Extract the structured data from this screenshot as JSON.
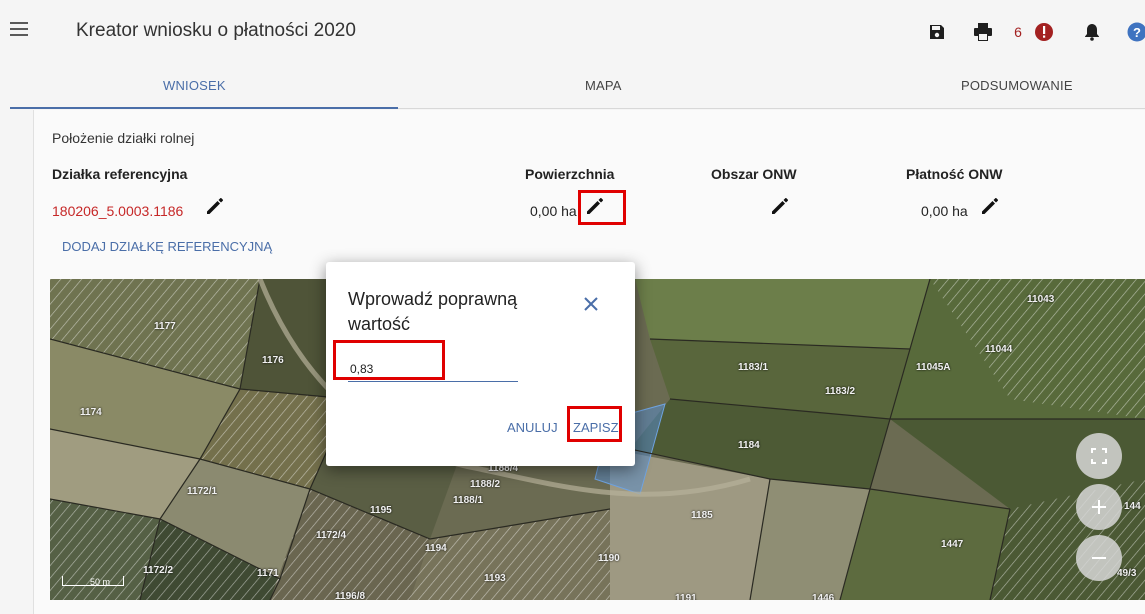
{
  "header": {
    "title": "Kreator wniosku o płatności 2020",
    "alert_count": "6",
    "icons": [
      "menu-icon",
      "save-icon",
      "print-icon",
      "alert-icon",
      "bell-icon",
      "help-icon"
    ]
  },
  "tabs": [
    {
      "label": "WNIOSEK",
      "active": true
    },
    {
      "label": "MAPA",
      "active": false
    },
    {
      "label": "PODSUMOWANIE",
      "active": false
    }
  ],
  "section": {
    "title": "Położenie działki rolnej",
    "columns": {
      "dzialka": "Działka referencyjna",
      "powierzchnia": "Powierzchnia",
      "obszar": "Obszar ONW",
      "platnosc": "Płatność ONW"
    },
    "row": {
      "dzialka": "180206_5.0003.1186",
      "powierzchnia": "0,00 ha",
      "platnosc": "0,00 ha"
    },
    "add_link": "DODAJ DZIAŁKĘ REFERENCYJNĄ"
  },
  "map": {
    "labels": [
      "1177",
      "1176",
      "1174",
      "1172/1",
      "1172/2",
      "1172/4",
      "1171",
      "1196/8",
      "1195",
      "1194",
      "1193",
      "1188/1",
      "1188/2",
      "1188/4",
      "1190",
      "1191",
      "1185",
      "1184",
      "1183/1",
      "1183/2",
      "11043",
      "11044",
      "11045A",
      "1447",
      "1446",
      "144",
      "49/3"
    ],
    "scale": "50 m"
  },
  "dialog": {
    "title": "Wprowadź poprawną wartość",
    "input_value": "0,83",
    "cancel_label": "ANULUJ",
    "save_label": "ZAPISZ"
  },
  "colors": {
    "accent": "#4a6ea8",
    "parcel_id": "#c62828",
    "highlight": "#e00000"
  }
}
